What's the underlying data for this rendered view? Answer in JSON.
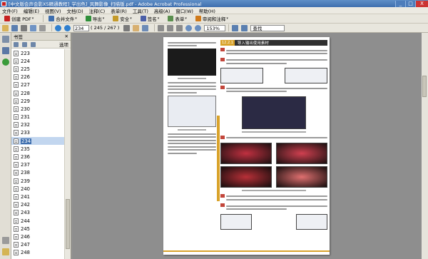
{
  "window": {
    "title": "[中文版会声会影X5精通教程]_学出色]_风舞影像_扫描版.pdf - Adobe Acrobat Professional",
    "controls": [
      "_",
      "□",
      "X"
    ]
  },
  "menu": [
    "文件(F)",
    "编辑(E)",
    "视图(V)",
    "文档(D)",
    "注释(C)",
    "表单(R)",
    "工具(T)",
    "高级(A)",
    "窗口(W)",
    "帮助(H)"
  ],
  "toolbar1": {
    "create_pdf": "创建 PDF",
    "combine": "合并文件",
    "export": "导出",
    "secure": "安全",
    "sign": "签名",
    "forms": "表单",
    "review": "审阅和注释",
    "colors": {
      "create": "#c62020",
      "combine": "#3f6fae",
      "export": "#2f8f3a",
      "secure": "#c49a2a",
      "sign": "#4b5fa8",
      "forms": "#5a8f4e",
      "review": "#d07a1a"
    }
  },
  "toolbar2": {
    "page_current": "234",
    "page_count": "( 245 / 267 )",
    "zoom": "153%",
    "find_placeholder": "查找"
  },
  "bookmarks": {
    "header": "书签",
    "options": "选项",
    "items": [
      "223",
      "224",
      "225",
      "226",
      "227",
      "228",
      "229",
      "230",
      "231",
      "232",
      "233",
      "234",
      "235",
      "236",
      "237",
      "238",
      "239",
      "240",
      "241",
      "242",
      "243",
      "244",
      "245",
      "246",
      "247",
      "248"
    ],
    "selected": "234"
  },
  "document": {
    "section_number": "12.2.1",
    "section_title": "导入输出使用素材"
  }
}
